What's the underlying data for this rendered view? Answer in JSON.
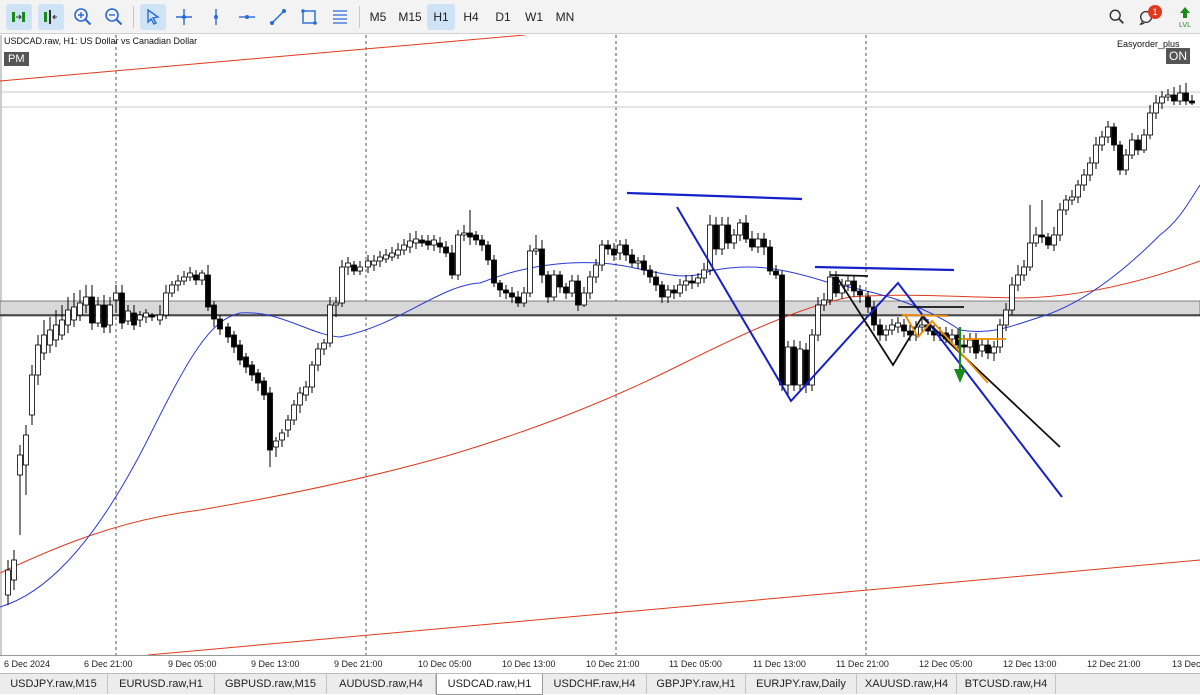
{
  "toolbar": {
    "tools": [
      {
        "icon": "autoscroll-icon"
      },
      {
        "icon": "chart-shift-icon"
      },
      {
        "icon": "zoom-in-icon"
      },
      {
        "icon": "zoom-out-icon"
      },
      {
        "icon": "cursor-icon"
      },
      {
        "icon": "crosshair-icon"
      },
      {
        "icon": "vertical-line-icon"
      },
      {
        "icon": "horizontal-line-icon"
      },
      {
        "icon": "trendline-icon"
      },
      {
        "icon": "rectangle-icon"
      },
      {
        "icon": "fibonacci-icon"
      }
    ],
    "timeframes": [
      "M5",
      "M15",
      "H1",
      "H4",
      "D1",
      "W1",
      "MN"
    ],
    "active_timeframe": "H1",
    "notification_count": "1",
    "lvl_label": "LVL"
  },
  "chart": {
    "title": "USDCAD.raw, H1:  US Dollar vs Canadian Dollar",
    "pm_label": "PM",
    "on_label": "ON",
    "easyorder_label": "Easyorder_plus",
    "x_labels": [
      "6 Dec 2024",
      "6 Dec 21:00",
      "9 Dec 05:00",
      "9 Dec 13:00",
      "9 Dec 21:00",
      "10 Dec 05:00",
      "10 Dec 13:00",
      "10 Dec 21:00",
      "11 Dec 05:00",
      "11 Dec 13:00",
      "11 Dec 21:00",
      "12 Dec 05:00",
      "12 Dec 13:00",
      "12 Dec 21:00",
      "13 Dec"
    ]
  },
  "tabs": [
    "USDJPY.raw,M15",
    "EURUSD.raw,H1",
    "GBPUSD.raw,M15",
    "AUDUSD.raw,H4",
    "USDCAD.raw,H1",
    "USDCHF.raw,H4",
    "GBPJPY.raw,H1",
    "EURJPY.raw,Daily",
    "XAUUSD.raw,H4",
    "BTCUSD.raw,H4"
  ],
  "active_tab": "USDCAD.raw,H1",
  "colors": {
    "bull": "#ffffff",
    "bear": "#000000",
    "ma_fast": "#2a39d8",
    "ma_slow": "#e03a1e",
    "pattern_blue": "#1420c8",
    "pattern_orange": "#f08c00",
    "arrow_green": "#1a8a1a"
  }
}
